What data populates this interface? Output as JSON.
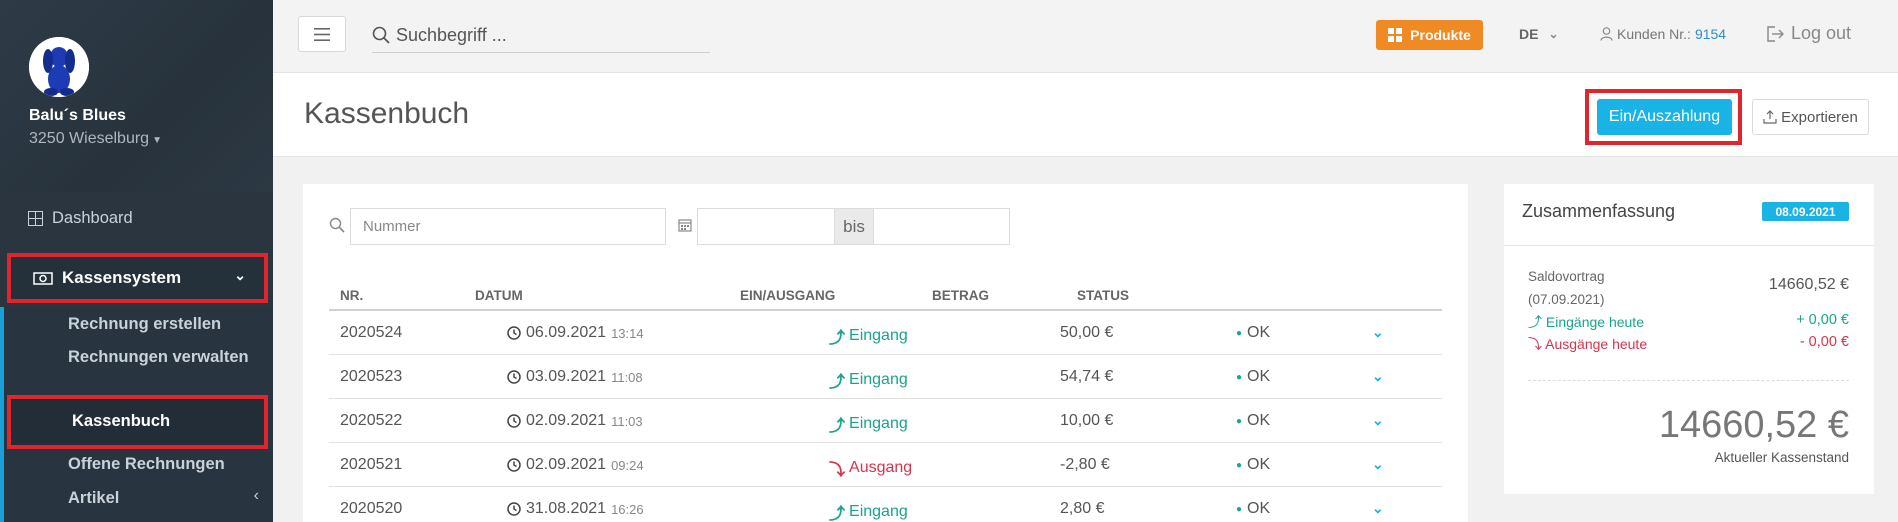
{
  "sidebar": {
    "shop_name": "Balu´s Blues",
    "shop_location": "3250 Wieselburg",
    "nav": {
      "dashboard": "Dashboard",
      "kassensystem": "Kassensystem",
      "items": [
        {
          "label": "Rechnung erstellen"
        },
        {
          "label": "Rechnungen verwalten"
        },
        {
          "label": "Kassenbuch",
          "active": true
        },
        {
          "label": "Offene Rechnungen"
        },
        {
          "label": "Artikel"
        }
      ]
    }
  },
  "topbar": {
    "search_placeholder": "Suchbegriff ...",
    "produkte": "Produkte",
    "language": "DE",
    "kunden_label": "Kunden Nr.:",
    "kunden_nr": "9154",
    "logout": "Log out"
  },
  "page": {
    "title": "Kassenbuch",
    "btn_einaus": "Ein/Auszahlung",
    "btn_export": "Exportieren"
  },
  "filters": {
    "nummer_placeholder": "Nummer",
    "bis": "bis"
  },
  "table": {
    "headers": {
      "nr": "NR.",
      "datum": "DATUM",
      "io": "EIN/AUSGANG",
      "betrag": "BETRAG",
      "status": "STATUS"
    },
    "rows": [
      {
        "nr": "2020524",
        "date": "06.09.2021",
        "time": "13:14",
        "io": "Eingang",
        "type": "in",
        "amount": "50,00 €",
        "status": "OK"
      },
      {
        "nr": "2020523",
        "date": "03.09.2021",
        "time": "11:08",
        "io": "Eingang",
        "type": "in",
        "amount": "54,74 €",
        "status": "OK"
      },
      {
        "nr": "2020522",
        "date": "02.09.2021",
        "time": "11:03",
        "io": "Eingang",
        "type": "in",
        "amount": "10,00 €",
        "status": "OK"
      },
      {
        "nr": "2020521",
        "date": "02.09.2021",
        "time": "09:24",
        "io": "Ausgang",
        "type": "out",
        "amount": "-2,80 €",
        "status": "OK"
      },
      {
        "nr": "2020520",
        "date": "31.08.2021",
        "time": "16:26",
        "io": "Eingang",
        "type": "in",
        "amount": "2,80 €",
        "status": "OK"
      }
    ]
  },
  "summary": {
    "title": "Zusammenfassung",
    "date": "08.09.2021",
    "saldo_label": "Saldovortrag",
    "saldo_date": "(07.09.2021)",
    "saldo_value": "14660,52 €",
    "eingaenge_label": "Eingänge heute",
    "eingaenge_value": "+ 0,00 €",
    "ausgaenge_label": "Ausgänge heute",
    "ausgaenge_value": "- 0,00 €",
    "kassenstand_value": "14660,52 €",
    "kassenstand_label": "Aktueller Kassenstand"
  },
  "colors": {
    "accent": "#1ab3e6",
    "orange": "#f08a24",
    "highlight": "#e0262c",
    "in": "#18a58a",
    "out": "#d8334a",
    "sidebar": "#2f3a45"
  }
}
